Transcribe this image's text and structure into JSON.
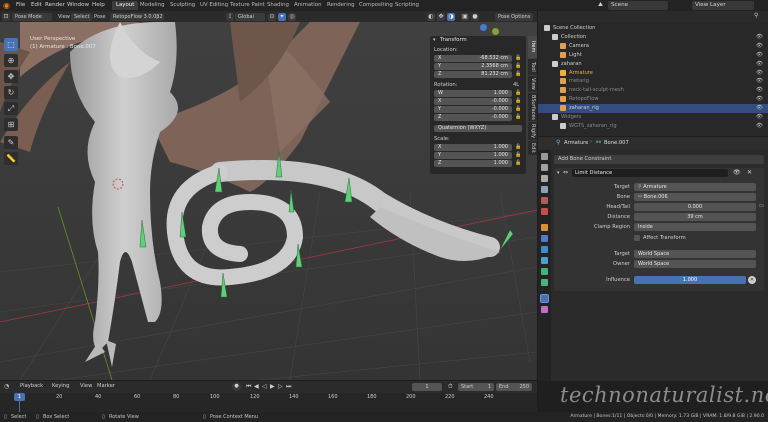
{
  "topbar": {
    "menus": [
      "File",
      "Edit",
      "Render",
      "Window",
      "Help"
    ],
    "workspaces": [
      "Layout",
      "Modeling",
      "Sculpting",
      "UV Editing",
      "Texture Paint",
      "Shading",
      "Animation",
      "Rendering",
      "Compositing",
      "Scripting"
    ],
    "active_workspace": "Layout",
    "scene_label": "Scene",
    "view_layer_label": "View Layer"
  },
  "viewport_header": {
    "mode": "Pose Mode",
    "menus": [
      "View",
      "Select",
      "Pose"
    ],
    "addon": "RetopoFlow 3.0.0β2",
    "transform_orientation": "Global",
    "pose_options": "Pose Options"
  },
  "viewport": {
    "overlay_line1": "User Perspective",
    "overlay_line2": "(1) Armature : Bone.007",
    "side_tabs": [
      "Item",
      "Tool",
      "View",
      "BSurfaces",
      "Rigify",
      "Edit"
    ],
    "tools": [
      "select",
      "cursor",
      "move",
      "rotate",
      "scale",
      "transform",
      "annotate",
      "measure"
    ]
  },
  "npanel": {
    "title": "Transform",
    "location_label": "Location:",
    "location": [
      {
        "axis": "X",
        "value": "-68.532 cm"
      },
      {
        "axis": "Y",
        "value": "2.3568 cm"
      },
      {
        "axis": "Z",
        "value": "81.232 cm"
      }
    ],
    "rotation_label": "Rotation:",
    "rotation_mode_short": "4L",
    "rotation": [
      {
        "axis": "W",
        "value": "1.000"
      },
      {
        "axis": "X",
        "value": "-0.000"
      },
      {
        "axis": "Y",
        "value": "-0.000"
      },
      {
        "axis": "Z",
        "value": "-0.000"
      }
    ],
    "rotation_mode": "Quaternion (WXYZ)",
    "scale_label": "Scale:",
    "scale": [
      {
        "axis": "X",
        "value": "1.000"
      },
      {
        "axis": "Y",
        "value": "1.000"
      },
      {
        "axis": "Z",
        "value": "1.000"
      }
    ]
  },
  "outliner": {
    "rows": [
      {
        "name": "Scene Collection",
        "indent": 0,
        "color": "#cccccc",
        "state": "normal"
      },
      {
        "name": "Collection",
        "indent": 1,
        "color": "#cccccc",
        "state": "normal"
      },
      {
        "name": "Camera",
        "indent": 2,
        "color": "#e0a050",
        "state": "normal"
      },
      {
        "name": "Light",
        "indent": 2,
        "color": "#e0a050",
        "state": "normal"
      },
      {
        "name": "zaharan",
        "indent": 1,
        "color": "#cccccc",
        "state": "normal"
      },
      {
        "name": "Armature",
        "indent": 2,
        "color": "#f0b040",
        "state": "active"
      },
      {
        "name": "metarig",
        "indent": 2,
        "color": "#e0a050",
        "state": "dim"
      },
      {
        "name": "neck-tail-sculpt-mesh",
        "indent": 2,
        "color": "#e0a050",
        "state": "dim"
      },
      {
        "name": "RetopoFlow",
        "indent": 2,
        "color": "#e0a050",
        "state": "dim"
      },
      {
        "name": "zaharan_rig",
        "indent": 2,
        "color": "#e0a050",
        "state": "selected"
      },
      {
        "name": "Widgets",
        "indent": 1,
        "color": "#cccccc",
        "state": "dim"
      },
      {
        "name": "WGTS_zaharan_rig",
        "indent": 2,
        "color": "#cccccc",
        "state": "dim"
      }
    ]
  },
  "properties": {
    "breadcrumb_object": "Armature",
    "breadcrumb_bone": "Bone.007",
    "add_constraint": "Add Bone Constraint",
    "constraint_name": "Limit Distance",
    "target_label": "Target",
    "target_value": "Armature",
    "bone_label": "Bone",
    "bone_value": "Bone.006",
    "headtail_label": "Head/Tail",
    "headtail_value": "0.000",
    "distance_label": "Distance",
    "distance_value": "39 cm",
    "clamp_label": "Clamp Region",
    "clamp_value": "Inside",
    "affect_transform": "Affect Transform",
    "target_space_label": "Target",
    "target_space_value": "World Space",
    "owner_space_label": "Owner",
    "owner_space_value": "World Space",
    "influence_label": "Influence",
    "influence_value": "1.000",
    "influence_fraction": 1.0
  },
  "timeline": {
    "menus": [
      "Playback",
      "Keying",
      "View",
      "Marker"
    ],
    "current_frame": "1",
    "start_label": "Start",
    "start_value": "1",
    "end_label": "End",
    "end_value": "250",
    "ticks": [
      "1",
      "20",
      "40",
      "60",
      "80",
      "100",
      "120",
      "140",
      "160",
      "180",
      "200",
      "220",
      "240"
    ]
  },
  "statusbar": {
    "left_items": [
      "Select",
      "Box Select",
      "Rotate View",
      "Pose Context Menu"
    ],
    "stats": "Armature | Bones:1/11 | Objects:0/0 | Memory: 1.73 GiB | VRAM: 1.8/9.8 GiB | 2.90.0"
  },
  "watermark": "technonaturalist.net",
  "colors": {
    "accent": "#4772b3",
    "viewport_bg": "#3c3c3c",
    "bone_green": "#5fd07a",
    "mesh": "#c9c9c9"
  }
}
